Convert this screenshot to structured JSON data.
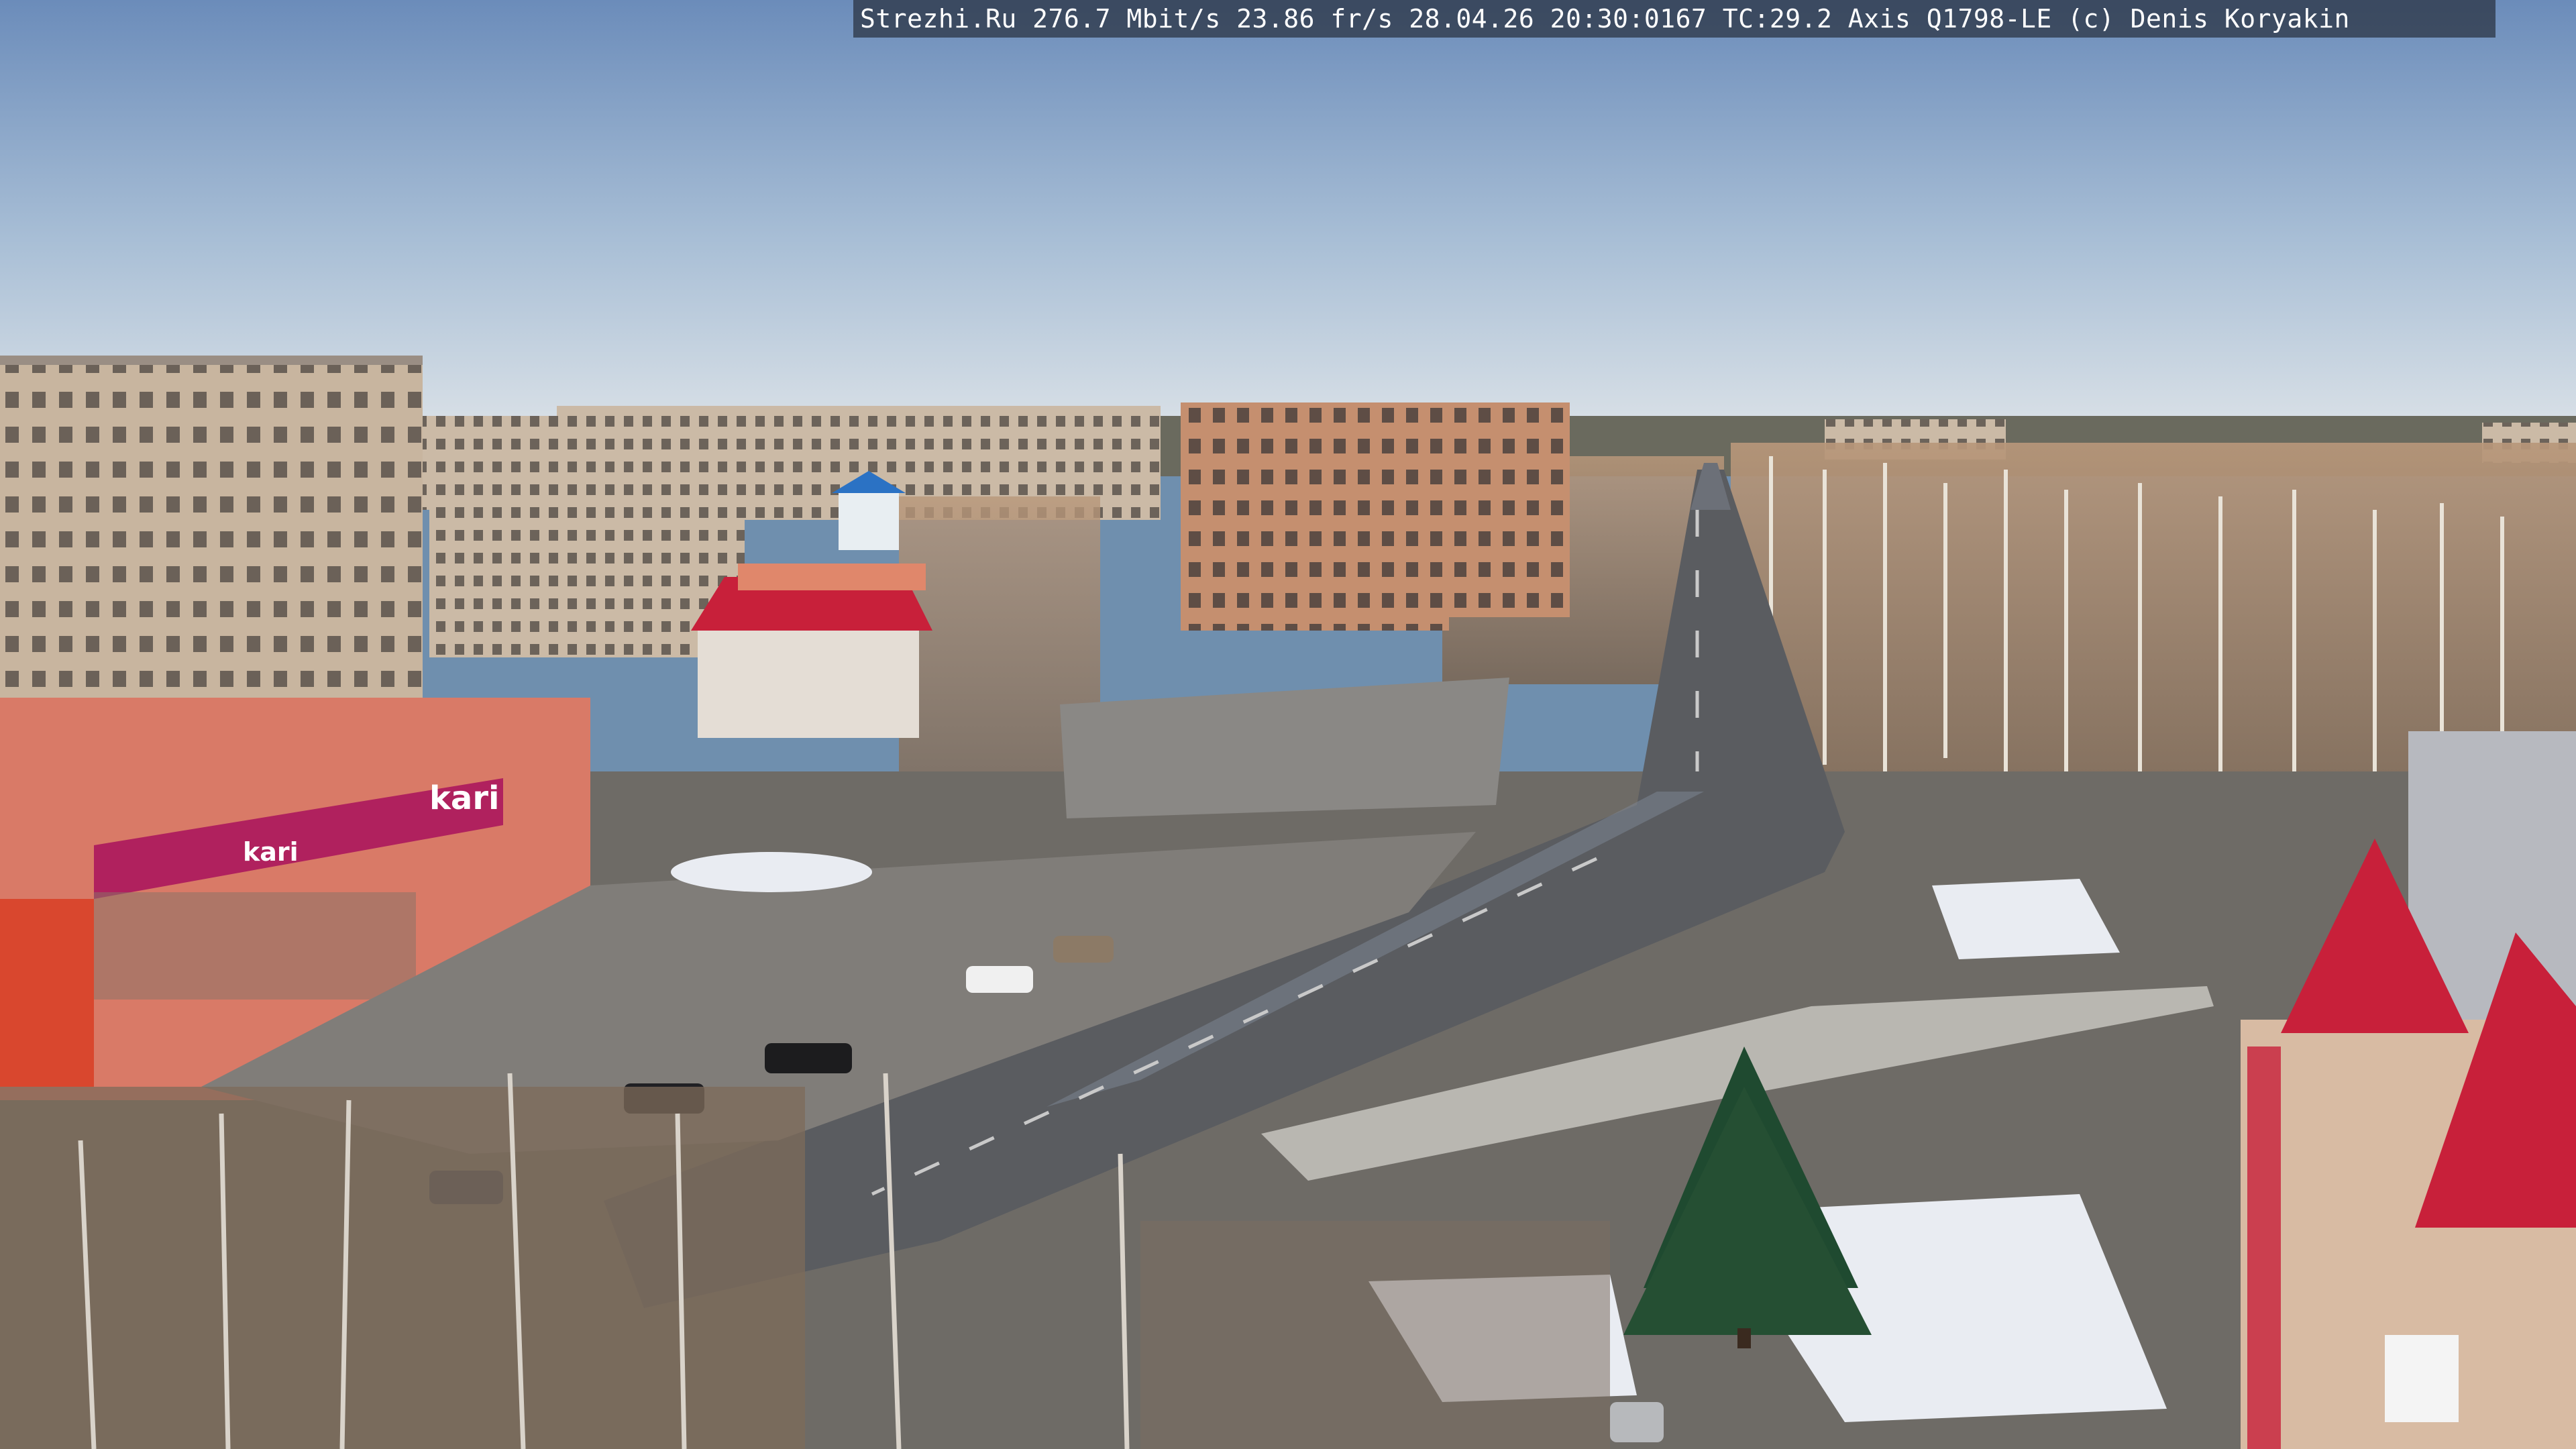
{
  "overlay": {
    "text": "Strezhi.Ru 276.7 Mbit/s 23.86 fr/s 28.04.26 20:30:0167 TC:29.2  Axis Q1798-LE  (c) Denis Koryakin"
  },
  "signs": {
    "store_left": "kari",
    "store_left_small": "kari"
  },
  "colors": {
    "sky_top": "#6f8fbb",
    "sky_bottom": "#d4dde6",
    "road": "#5a5c60",
    "plaza": "#7d7c7a",
    "roof_red": "#c8203a",
    "building_beige": "#c9b39d",
    "shop_pink": "#d97a67",
    "shop_magenta": "#b0215e"
  }
}
